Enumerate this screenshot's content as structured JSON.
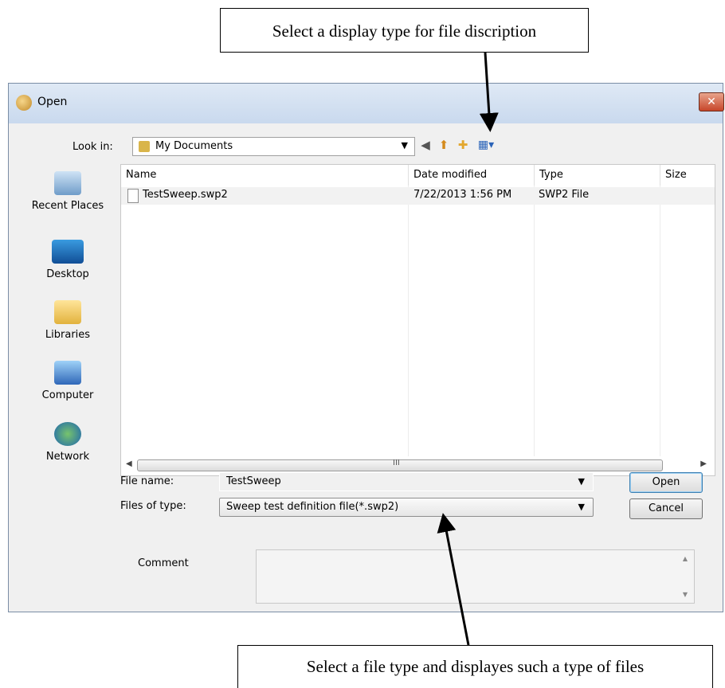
{
  "annotations": {
    "top": "Select a display type for file discription",
    "bottom": "Select a file type and displayes such a type of files"
  },
  "dialog": {
    "title": "Open",
    "close_glyph": "✕",
    "look_in_label": "Look in:",
    "look_in_value": "My Documents",
    "toolbar_icons": [
      "back-icon",
      "up-folder-icon",
      "new-folder-icon",
      "view-menu-icon"
    ]
  },
  "places": [
    "Recent Places",
    "Desktop",
    "Libraries",
    "Computer",
    "Network"
  ],
  "file_list": {
    "columns": [
      "Name",
      "Date modified",
      "Type",
      "Size"
    ],
    "rows": [
      {
        "name": "TestSweep.swp2",
        "date": "7/22/2013 1:56 PM",
        "type": "SWP2 File",
        "size": ""
      }
    ],
    "scroll_grip": "III"
  },
  "form": {
    "file_name_label": "File name:",
    "file_name_value": "TestSweep",
    "files_of_type_label": "Files of type:",
    "files_of_type_value": "Sweep test definition file(*.swp2)",
    "open_label": "Open",
    "cancel_label": "Cancel",
    "comment_label": "Comment"
  },
  "colors": {
    "titlebar": "#c9d9ee",
    "close": "#c7462a",
    "dialog_bg": "#f0f0f0"
  }
}
